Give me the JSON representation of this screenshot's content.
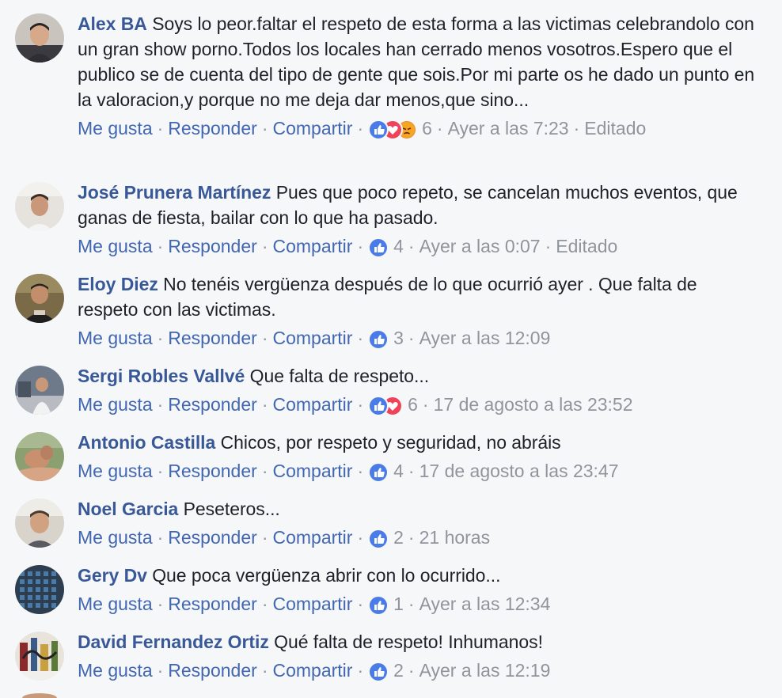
{
  "labels": {
    "like": "Me gusta",
    "reply": "Responder",
    "share": "Compartir",
    "sep": "·"
  },
  "colors": {
    "author": "#385898",
    "action": "#4267b2",
    "meta": "#90949c",
    "like_reaction": "#4a7ce8",
    "love_reaction": "#f0435a",
    "angry_reaction": "#f08a30"
  },
  "comments": [
    {
      "author": "Alex BA",
      "text": "Soys lo peor.faltar el respeto de esta forma a las victimas celebrandolo con un gran show porno.Todos los locales han cerrado menos vosotros.Espero que el publico se de cuenta del tipo de gente que sois.Por mi parte os he dado un punto en la valoracion,y porque no me deja dar menos,que sino...",
      "reactions": [
        "like-icon",
        "love-icon",
        "angry-icon"
      ],
      "count": "6",
      "time": "Ayer a las 7:23",
      "edited": "Editado"
    },
    {
      "author": "José Prunera Martínez",
      "text": "Pues que poco repeto, se cancelan muchos eventos, que ganas de fiesta, bailar con lo que ha pasado.",
      "reactions": [
        "like-icon"
      ],
      "count": "4",
      "time": "Ayer a las 0:07",
      "edited": "Editado"
    },
    {
      "author": "Eloy Diez",
      "text": "No tenéis vergüenza después de lo que ocurrió ayer . Que falta de respeto con las victimas.",
      "reactions": [
        "like-icon"
      ],
      "count": "3",
      "time": "Ayer a las 12:09",
      "edited": ""
    },
    {
      "author": "Sergi Robles Vallvé",
      "text": "Que falta de respeto...",
      "reactions": [
        "like-icon",
        "love-icon"
      ],
      "count": "6",
      "time": "17 de agosto a las 23:52",
      "edited": ""
    },
    {
      "author": "Antonio Castilla",
      "text": "Chicos, por respeto y seguridad, no abráis",
      "reactions": [
        "like-icon"
      ],
      "count": "4",
      "time": "17 de agosto a las 23:47",
      "edited": ""
    },
    {
      "author": "Noel Garcia",
      "text": "Peseteros...",
      "reactions": [
        "like-icon"
      ],
      "count": "2",
      "time": "21 horas",
      "edited": ""
    },
    {
      "author": "Gery Dv",
      "text": "Que poca vergüenza abrir con lo ocurrido...",
      "reactions": [
        "like-icon"
      ],
      "count": "1",
      "time": "Ayer a las 12:34",
      "edited": ""
    },
    {
      "author": "David Fernandez Ortiz",
      "text": "Qué falta de respeto! Inhumanos!",
      "reactions": [
        "like-icon"
      ],
      "count": "2",
      "time": "Ayer a las 12:19",
      "edited": ""
    }
  ]
}
